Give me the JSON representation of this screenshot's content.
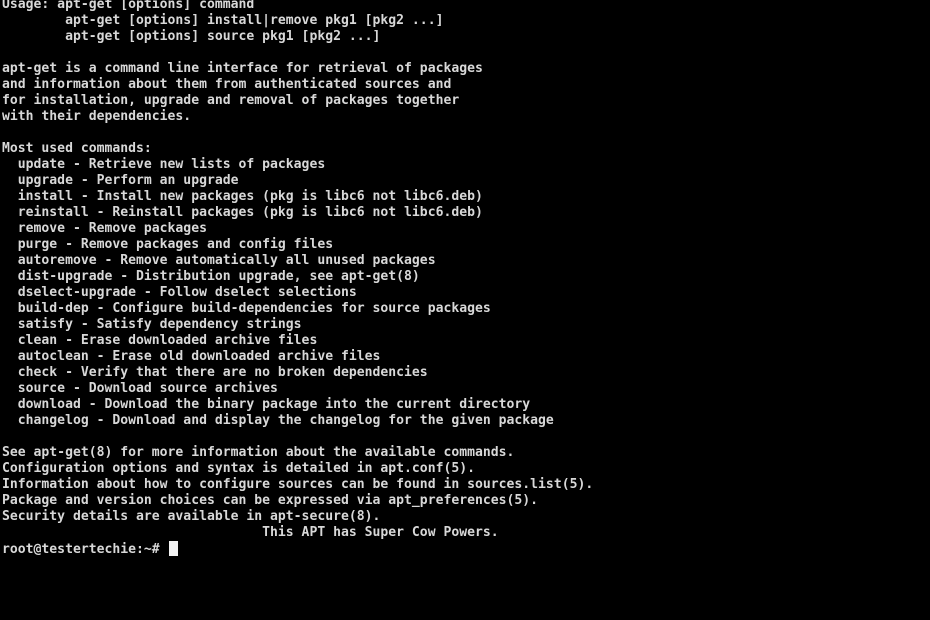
{
  "terminal": {
    "background_color": "#000000",
    "text_color": "#d8d8d8",
    "cursor_color": "#f2f2f2",
    "lines": [
      "Usage: apt-get [options] command",
      "        apt-get [options] install|remove pkg1 [pkg2 ...]",
      "        apt-get [options] source pkg1 [pkg2 ...]",
      "",
      "apt-get is a command line interface for retrieval of packages",
      "and information about them from authenticated sources and",
      "for installation, upgrade and removal of packages together",
      "with their dependencies.",
      "",
      "Most used commands:",
      "  update - Retrieve new lists of packages",
      "  upgrade - Perform an upgrade",
      "  install - Install new packages (pkg is libc6 not libc6.deb)",
      "  reinstall - Reinstall packages (pkg is libc6 not libc6.deb)",
      "  remove - Remove packages",
      "  purge - Remove packages and config files",
      "  autoremove - Remove automatically all unused packages",
      "  dist-upgrade - Distribution upgrade, see apt-get(8)",
      "  dselect-upgrade - Follow dselect selections",
      "  build-dep - Configure build-dependencies for source packages",
      "  satisfy - Satisfy dependency strings",
      "  clean - Erase downloaded archive files",
      "  autoclean - Erase old downloaded archive files",
      "  check - Verify that there are no broken dependencies",
      "  source - Download source archives",
      "  download - Download the binary package into the current directory",
      "  changelog - Download and display the changelog for the given package",
      "",
      "See apt-get(8) for more information about the available commands.",
      "Configuration options and syntax is detailed in apt.conf(5).",
      "Information about how to configure sources can be found in sources.list(5).",
      "Package and version choices can be expressed via apt_preferences(5).",
      "Security details are available in apt-secure(8).",
      "                                 This APT has Super Cow Powers."
    ],
    "prompt": {
      "user": "root",
      "at": "@",
      "host": "testertechie",
      "separator": ":",
      "path": "~",
      "symbol": "#",
      "full": "root@testertechie:~# ",
      "input_value": ""
    }
  }
}
